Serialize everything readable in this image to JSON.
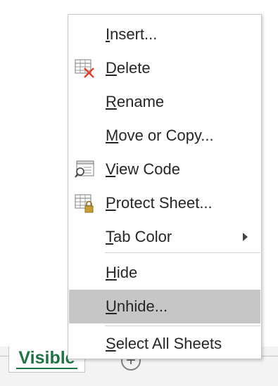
{
  "menu": {
    "items": [
      {
        "name": "insert",
        "accel": "I",
        "rest": "nsert...",
        "icon": null
      },
      {
        "name": "delete",
        "accel": "D",
        "rest": "elete",
        "icon": "delete-sheet-icon"
      },
      {
        "name": "rename",
        "accel": "R",
        "rest": "ename",
        "icon": null
      },
      {
        "name": "move-or-copy",
        "accel": "M",
        "rest": "ove or Copy...",
        "icon": null
      },
      {
        "name": "view-code",
        "accel": "V",
        "rest": "iew Code",
        "icon": "view-code-icon"
      },
      {
        "name": "protect-sheet",
        "accel": "P",
        "rest": "rotect Sheet...",
        "icon": "protect-sheet-icon"
      },
      {
        "name": "tab-color",
        "pre": "",
        "accel": "T",
        "rest": "ab Color",
        "icon": null,
        "submenu": true
      },
      {
        "name": "hide",
        "accel": "H",
        "rest": "ide",
        "icon": null
      },
      {
        "name": "unhide",
        "accel": "U",
        "rest": "nhide...",
        "icon": null,
        "highlighted": true
      },
      {
        "name": "select-all-sheets",
        "accel": "S",
        "rest": "elect All Sheets",
        "icon": null
      }
    ]
  },
  "tabs": {
    "active_sheet": "Visible",
    "add_sheet_glyph": "+"
  },
  "colors": {
    "accent_green": "#217346",
    "highlight": "#c6c6c6",
    "delete_red": "#d9432f",
    "lock_gold": "#c8a032"
  }
}
